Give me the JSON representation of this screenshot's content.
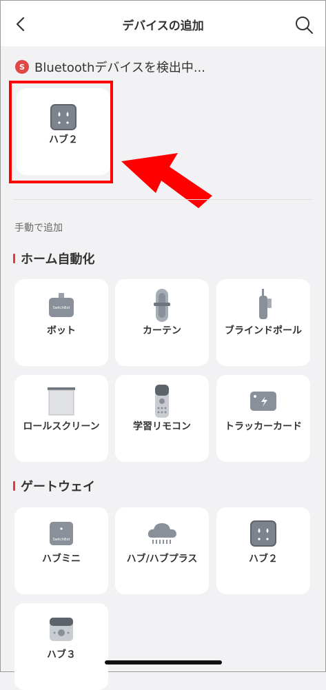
{
  "header": {
    "title": "デバイスの追加"
  },
  "scan": {
    "badge": "S",
    "text": "Bluetoothデバイスを検出中..."
  },
  "found": [
    {
      "label": "ハブ２",
      "icon": "hub2-icon"
    }
  ],
  "manual_label": "手動で追加",
  "sections": [
    {
      "title": "ホーム自動化",
      "items": [
        {
          "label": "ボット",
          "icon": "bot-icon"
        },
        {
          "label": "カーテン",
          "icon": "curtain-icon"
        },
        {
          "label": "ブラインドポール",
          "icon": "blind-tilt-icon"
        },
        {
          "label": "ロールスクリーン",
          "icon": "roller-shade-icon"
        },
        {
          "label": "学習リモコン",
          "icon": "remote-icon"
        },
        {
          "label": "トラッカーカード",
          "icon": "tracker-card-icon"
        }
      ]
    },
    {
      "title": "ゲートウェイ",
      "items": [
        {
          "label": "ハブミニ",
          "icon": "hub-mini-icon"
        },
        {
          "label": "ハブ/ハブプラス",
          "icon": "hub-plus-icon"
        },
        {
          "label": "ハブ２",
          "icon": "hub2-icon"
        },
        {
          "label": "ハブ３",
          "icon": "hub3-icon"
        }
      ]
    }
  ],
  "colors": {
    "accent": "#e23b3b",
    "highlight": "#ff0000",
    "icon": "#8a9099"
  }
}
